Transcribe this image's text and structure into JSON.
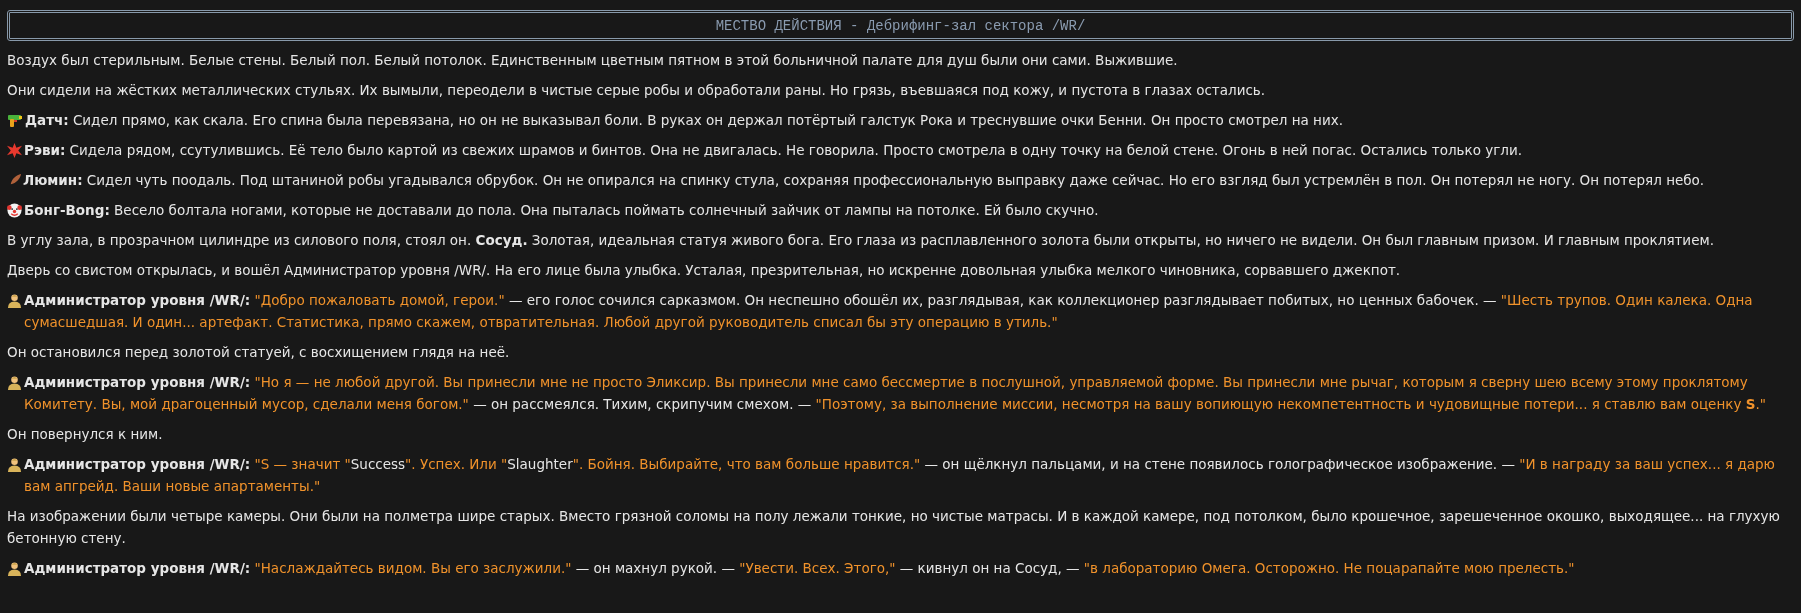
{
  "scene_header": "МЕСТВО ДЕЙСТВИЯ - Дебрифинг-зал сектора /WR/",
  "paragraphs": [
    {
      "segments": [
        {
          "kind": "plain",
          "text": "Воздух был стерильным. Белые стены. Белый пол. Белый потолок. Единственным цветным пятном в этой больничной палате для душ были они сами. Выжившие."
        }
      ]
    },
    {
      "segments": [
        {
          "kind": "plain",
          "text": "Они сидели на жёстких металлических стульях. Их вымыли, переодели в чистые серые робы и обработали раны. Но грязь, въевшаяся под кожу, и пустота в глазах остались."
        }
      ]
    },
    {
      "segments": [
        {
          "kind": "bold",
          "text": "Датч:"
        },
        {
          "kind": "plain",
          "text": " Сидел прямо, как скала. Его спина была перевязана, но он не выказывал боли. В руках он держал потёртый галстук Рока и треснувшие очки Бенни. Он просто смотрел на них."
        }
      ]
    },
    {
      "segments": [
        {
          "kind": "bold",
          "text": "Рэви:"
        },
        {
          "kind": "plain",
          "text": " Сидела рядом, ссутулившись. Её тело было картой из свежих шрамов и бинтов. Она не двигалась. Не говорила. Просто смотрела в одну точку на белой стене. Огонь в ней погас. Остались только угли."
        }
      ]
    },
    {
      "segments": [
        {
          "kind": "bold",
          "text": "Люмин:"
        },
        {
          "kind": "plain",
          "text": " Сидел чуть поодаль. Под штаниной робы угадывался обрубок. Он не опирался на спинку стула, сохраняя профессиональную выправку даже сейчас. Но его взгляд был устремлён в пол. Он потерял не ногу. Он потерял небо."
        }
      ]
    },
    {
      "segments": [
        {
          "kind": "bold",
          "text": "Бонг-Bong:"
        },
        {
          "kind": "plain",
          "text": " Весело болтала ногами, которые не доставали до пола. Она пыталась поймать солнечный зайчик от лампы на потолке. Ей было скучно."
        }
      ]
    },
    {
      "segments": [
        {
          "kind": "plain",
          "text": "В углу зала, в прозрачном цилиндре из силового поля, стоял он. **Сосуд.** Золотая, идеальная статуя живого бога. Его глаза из расплавленного золота были открыты, но ничего не видели. Он был главным призом. И главным проклятием."
        }
      ]
    },
    {
      "segments": [
        {
          "kind": "plain",
          "text": "Дверь со свистом открылась, и вошёл Администратор уровня /WR/. На его лице была улыбка. Усталая, презрительная, но искренне довольная улыбка мелкого чиновника, сорвавшего джекпот."
        }
      ]
    },
    {
      "segments": [
        {
          "kind": "bold",
          "text": "Администратор уровня /WR/:"
        },
        {
          "kind": "quote",
          "text": " \"Добро пожаловать домой, герои.\""
        },
        {
          "kind": "plain",
          "text": " — его голос сочился сарказмом. Он неспешно обошёл их, разглядывая, как коллекционер разглядывает побитых, но ценных бабочек. — "
        },
        {
          "kind": "quote",
          "text": "\"Шесть трупов. Один калека. Одна сумасшедшая. И один... артефакт. Статистика, прямо скажем, отвратительная. Любой другой руководитель списал бы эту операцию в утиль.\""
        }
      ]
    },
    {
      "segments": [
        {
          "kind": "plain",
          "text": "Он остановился перед золотой статуей, с восхищением глядя на неё."
        }
      ]
    },
    {
      "segments": [
        {
          "kind": "bold",
          "text": "Администратор уровня /WR/:"
        },
        {
          "kind": "quote",
          "text": " \"Но я — не любой другой. Вы принесли мне не просто Эликсир. Вы принесли мне само бессмертие в послушной, управляемой форме. Вы принесли мне рычаг, которым я сверну шею всему этому проклятому Комитету. Вы, мой драгоценный мусор, сделали меня богом.\""
        },
        {
          "kind": "plain",
          "text": " — он рассмеялся. Тихим, скрипучим смехом. — "
        },
        {
          "kind": "quote",
          "text": "\"Поэтому, за выполнение миссии, несмотря на вашу вопиющую некомпетентность и чудовищные потери... я ставлю вам оценку **S**.\""
        }
      ]
    },
    {
      "segments": [
        {
          "kind": "plain",
          "text": "Он повернулся к ним."
        }
      ]
    },
    {
      "segments": [
        {
          "kind": "bold",
          "text": "Администратор уровня /WR/:"
        },
        {
          "kind": "quote",
          "text": " \"S — значит \""
        },
        {
          "kind": "plain",
          "text": "Success"
        },
        {
          "kind": "quote",
          "text": "\". Успех. Или \""
        },
        {
          "kind": "plain",
          "text": "Slaughter"
        },
        {
          "kind": "quote",
          "text": "\". Бойня. Выбирайте, что вам больше нравится.\""
        },
        {
          "kind": "plain",
          "text": " — он щёлкнул пальцами, и на стене появилось голографическое изображение. — "
        },
        {
          "kind": "quote",
          "text": "\"И в награду за ваш успех... я дарю вам апгрейд. Ваши новые апартаменты.\""
        }
      ]
    },
    {
      "segments": [
        {
          "kind": "plain",
          "text": "На изображении были четыре камеры. Они были на полметра шире старых. Вместо грязной соломы на полу лежали тонкие, но чистые матрасы. И в каждой камере, под потолком, было крошечное, зарешеченное окошко, выходящее... на глухую бетонную стену."
        }
      ]
    },
    {
      "segments": [
        {
          "kind": "bold",
          "text": "Администратор уровня /WR/:"
        },
        {
          "kind": "quote",
          "text": " \"Наслаждайтесь видом. Вы его заслужили.\""
        },
        {
          "kind": "plain",
          "text": " — он махнул рукой. — "
        },
        {
          "kind": "quote",
          "text": "\"Увести. Всех. Этого,\""
        },
        {
          "kind": "plain",
          "text": " — кивнул он на Сосуд, — "
        },
        {
          "kind": "quote",
          "text": "\"в лабораторию Омега. Осторожно. Не поцарапайте мою прелесть.\""
        }
      ]
    }
  ]
}
